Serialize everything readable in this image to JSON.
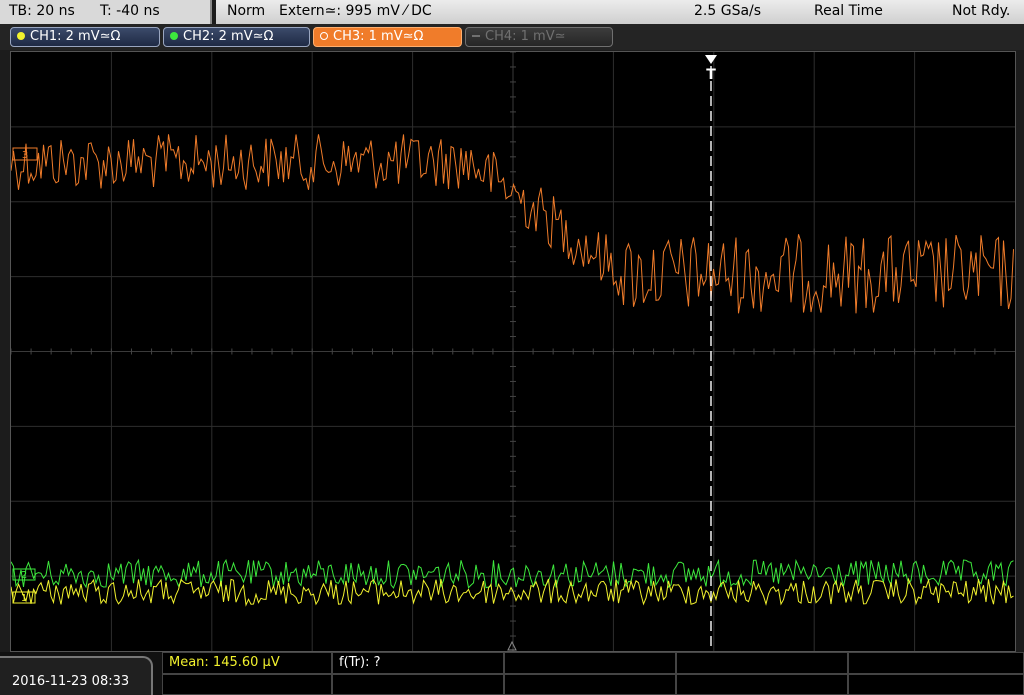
{
  "status_bar": {
    "timebase": "TB: 20 ns",
    "trigger_offset": "T: -40 ns",
    "acq_mode": "Norm",
    "trigger_source": "Extern≃: 995 mV ⁄ DC",
    "sample_rate": "2.5 GSa/s",
    "run_mode": "Real Time",
    "status": "Not Rdy."
  },
  "channels": [
    {
      "label": "CH1: 2 mV≃Ω",
      "color": "#f2f22e",
      "active": true
    },
    {
      "label": "CH2: 2 mV≃Ω",
      "color": "#3de83d",
      "active": true
    },
    {
      "label": "CH3: 1 mV≃Ω",
      "color": "#f07c2a",
      "active": true,
      "selected": true
    },
    {
      "label": "CH4: 1 mV≃",
      "color": "#707070",
      "active": false
    }
  ],
  "screen_markers": {
    "trigger_marker": "T",
    "ch3_marker": "3",
    "ch2_marker": "2",
    "ch1_marker": "1"
  },
  "footer": {
    "datetime": "2016-11-23 08:33",
    "measurements": [
      {
        "label": "Mean: 145.60 µV",
        "color": "#f2f22e"
      },
      {
        "label": "f(Tr): ?",
        "color": "#ffffff"
      }
    ]
  },
  "colors": {
    "ch1": "#f2f22e",
    "ch2": "#3de83d",
    "ch3": "#f07c2a",
    "grid": "#3a3a3a",
    "trigger_line": "#ffffff"
  }
}
